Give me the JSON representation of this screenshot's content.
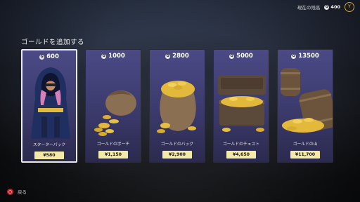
{
  "topbar": {
    "label": "現在の残高",
    "balance": "400"
  },
  "title": "ゴールドを追加する",
  "cards": [
    {
      "amount": "600",
      "name": "スターターパック",
      "price": "¥580",
      "selected": true
    },
    {
      "amount": "1000",
      "name": "ゴールドのポーチ",
      "price": "¥1,150",
      "selected": false
    },
    {
      "amount": "2800",
      "name": "ゴールドのバッグ",
      "price": "¥2,900",
      "selected": false
    },
    {
      "amount": "5000",
      "name": "ゴールドのチェスト",
      "price": "¥4,650",
      "selected": false
    },
    {
      "amount": "13500",
      "name": "ゴールドの山",
      "price": "¥11,700",
      "selected": false
    }
  ],
  "footer": {
    "back_label": "戻る"
  },
  "colors": {
    "buy": "#f3e9a8",
    "card_top": "#4b4a86",
    "card_bottom": "#2b2a4e",
    "back_button": "#c1272d"
  }
}
